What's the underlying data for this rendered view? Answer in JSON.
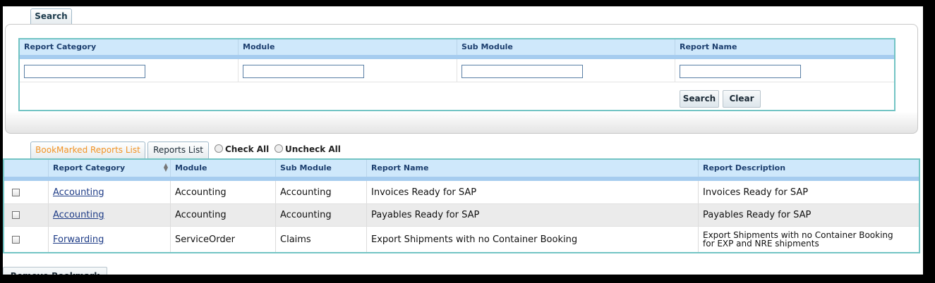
{
  "search": {
    "tab_label": "Search",
    "columns": [
      "Report Category",
      "Module",
      "Sub Module",
      "Report Name"
    ],
    "inputs": [
      "",
      "",
      "",
      ""
    ],
    "search_button": "Search",
    "clear_button": "Clear"
  },
  "tabs": {
    "bookmarked": "BookMarked Reports List",
    "reports": "Reports List",
    "active": "bookmarked"
  },
  "selection": {
    "check_all": "Check All",
    "uncheck_all": "Uncheck All"
  },
  "grid": {
    "headers": [
      "Report Category",
      "Module",
      "Sub Module",
      "Report Name",
      "Report Description"
    ],
    "rows": [
      {
        "category": "Accounting",
        "module": "Accounting",
        "sub_module": "Accounting",
        "report_name": "Invoices Ready for SAP",
        "description": "Invoices Ready for SAP"
      },
      {
        "category": "Accounting",
        "module": "Accounting",
        "sub_module": "Accounting",
        "report_name": "Payables Ready for SAP",
        "description": "Payables Ready for SAP"
      },
      {
        "category": "Forwarding",
        "module": "ServiceOrder",
        "sub_module": "Claims",
        "report_name": "Export Shipments with no Container Booking",
        "description": "Export Shipments with no Container Booking for EXP and NRE shipments"
      }
    ]
  },
  "actions": {
    "remove_bookmark": "Remove Bookmark"
  }
}
